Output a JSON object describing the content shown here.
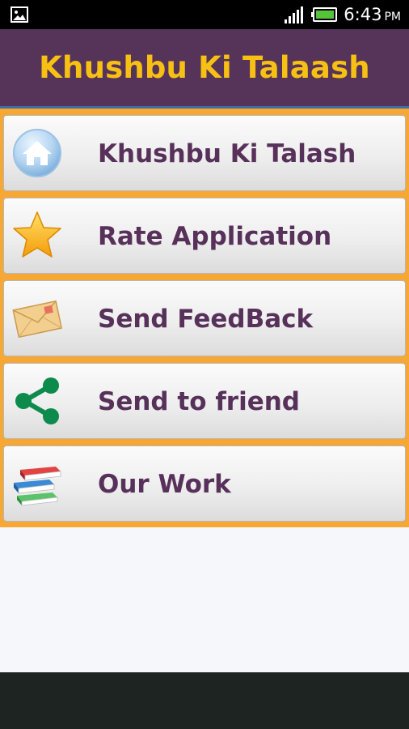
{
  "status_bar": {
    "time": "6:43",
    "ampm": "PM",
    "icons": [
      "gallery-icon",
      "signal-icon",
      "battery-icon"
    ]
  },
  "app": {
    "title": "Khushbu Ki Talaash"
  },
  "menu": {
    "items": [
      {
        "label": "Khushbu Ki Talash",
        "icon": "home-icon"
      },
      {
        "label": "Rate Application",
        "icon": "star-icon"
      },
      {
        "label": "Send FeedBack",
        "icon": "envelope-icon"
      },
      {
        "label": "Send to friend",
        "icon": "share-icon"
      },
      {
        "label": "Our Work",
        "icon": "books-icon"
      }
    ]
  },
  "colors": {
    "title_bar": "#563358",
    "title_text": "#f7c114",
    "menu_background": "#f7a733",
    "menu_label": "#57315a",
    "share_icon": "#0c8b4d",
    "nav_bar": "#1d2422"
  }
}
